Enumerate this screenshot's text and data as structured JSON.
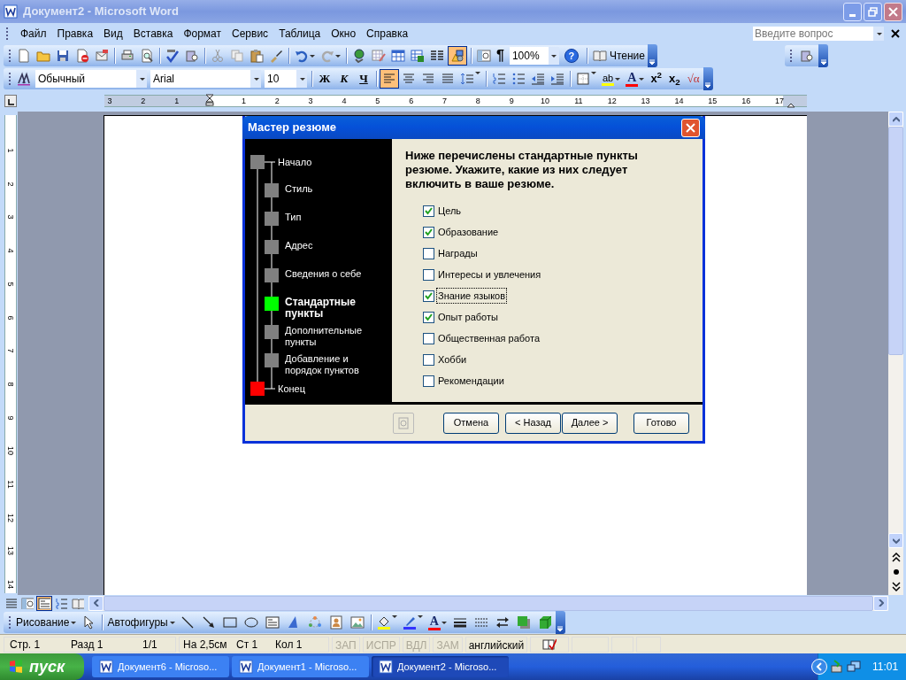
{
  "window": {
    "title": "Документ2 - Microsoft Word"
  },
  "menu": [
    {
      "label": "Файл"
    },
    {
      "label": "Правка"
    },
    {
      "label": "Вид"
    },
    {
      "label": "Вставка"
    },
    {
      "label": "Формат"
    },
    {
      "label": "Сервис"
    },
    {
      "label": "Таблица"
    },
    {
      "label": "Окно"
    },
    {
      "label": "Справка"
    }
  ],
  "help_search": {
    "placeholder": "Введите вопрос"
  },
  "standard_toolbar": {
    "drawing_toggle": {
      "selected": true
    },
    "pilcrow": "¶",
    "zoom": "100%",
    "help": "?",
    "reading_button": "Чтение"
  },
  "formatting_toolbar": {
    "style": "Обычный",
    "font": "Arial",
    "size": "10",
    "bold": "Ж",
    "italic": "К",
    "underline": "Ч",
    "alignment": [
      {
        "selected": true
      },
      {
        "selected": false
      },
      {
        "selected": false
      },
      {
        "selected": false
      }
    ],
    "highlight": "ab",
    "font_color": "A",
    "superscript": "x$^{2}$",
    "subscript": "x$_{2}$",
    "equation": "√α"
  },
  "horizontal_ruler": [
    "3",
    "2",
    "1",
    "1",
    "2",
    "3",
    "4",
    "5",
    "6",
    "7",
    "8",
    "9",
    "10",
    "11",
    "12",
    "13",
    "14",
    "15",
    "16",
    "17"
  ],
  "vertical_ruler": [
    "1",
    "2",
    "3",
    "4",
    "5",
    "6",
    "7",
    "8",
    "9",
    "10",
    "11",
    "12",
    "13",
    "14"
  ],
  "dialog": {
    "title": "Мастер резюме",
    "steps": [
      {
        "label": "Начало",
        "kind": "terminal",
        "color": "#808080",
        "selected": false
      },
      {
        "label": "Стиль",
        "kind": "step",
        "color": "#808080",
        "selected": false
      },
      {
        "label": "Тип",
        "kind": "step",
        "color": "#808080",
        "selected": false
      },
      {
        "label": "Адрес",
        "kind": "step",
        "color": "#808080",
        "selected": false
      },
      {
        "label": "Сведения о себе",
        "kind": "step",
        "color": "#808080",
        "selected": false
      },
      {
        "label": "Стандартные пункты",
        "kind": "step",
        "color": "#00ff00",
        "selected": true
      },
      {
        "label": "Дополнительные пункты",
        "kind": "step",
        "color": "#808080",
        "selected": false
      },
      {
        "label": "Добавление и порядок пунктов",
        "kind": "step",
        "color": "#808080",
        "selected": false
      },
      {
        "label": "Конец",
        "kind": "terminal",
        "color": "#ff0000",
        "selected": false
      }
    ],
    "heading": "Ниже перечислены стандартные пункты резюме.  Укажите, какие из них следует включить в ваше резюме.",
    "options": [
      {
        "label": "Цель",
        "checked": true,
        "focused": false
      },
      {
        "label": "Образование",
        "checked": true,
        "focused": false
      },
      {
        "label": "Награды",
        "checked": false,
        "focused": false
      },
      {
        "label": "Интересы и увлечения",
        "checked": false,
        "focused": false
      },
      {
        "label": "Знание языков",
        "checked": true,
        "focused": true
      },
      {
        "label": "Опыт работы",
        "checked": true,
        "focused": false
      },
      {
        "label": "Общественная работа",
        "checked": false,
        "focused": false
      },
      {
        "label": "Хобби",
        "checked": false,
        "focused": false
      },
      {
        "label": "Рекомендации",
        "checked": false,
        "focused": false
      }
    ],
    "buttons": [
      "Отмена",
      "< Назад",
      "Далее >",
      "Готово"
    ]
  },
  "view_modes": [
    {
      "selected": false
    },
    {
      "selected": false
    },
    {
      "selected": true
    },
    {
      "selected": false
    },
    {
      "selected": false
    }
  ],
  "drawing_toolbar": {
    "draw_menu": "Рисование",
    "autoshapes": "Автофигуры",
    "font_color": "A"
  },
  "status_bar": {
    "fields": [
      "Стр. 1",
      "Разд 1",
      "1/1",
      "На 2,5см",
      "Ст 1",
      "Кол 1"
    ],
    "modes": [
      {
        "label": "ЗАП",
        "enabled": false
      },
      {
        "label": "ИСПР",
        "enabled": false
      },
      {
        "label": "ВДЛ",
        "enabled": false
      },
      {
        "label": "ЗАМ",
        "enabled": false
      }
    ],
    "language": "английский"
  },
  "taskbar": {
    "start": "пуск",
    "tasks": [
      {
        "label": "Документ6 - Microso...",
        "selected": false
      },
      {
        "label": "Документ1 - Microso...",
        "selected": false
      },
      {
        "label": "Документ2 - Microso...",
        "selected": true
      }
    ],
    "clock": "11:01"
  }
}
